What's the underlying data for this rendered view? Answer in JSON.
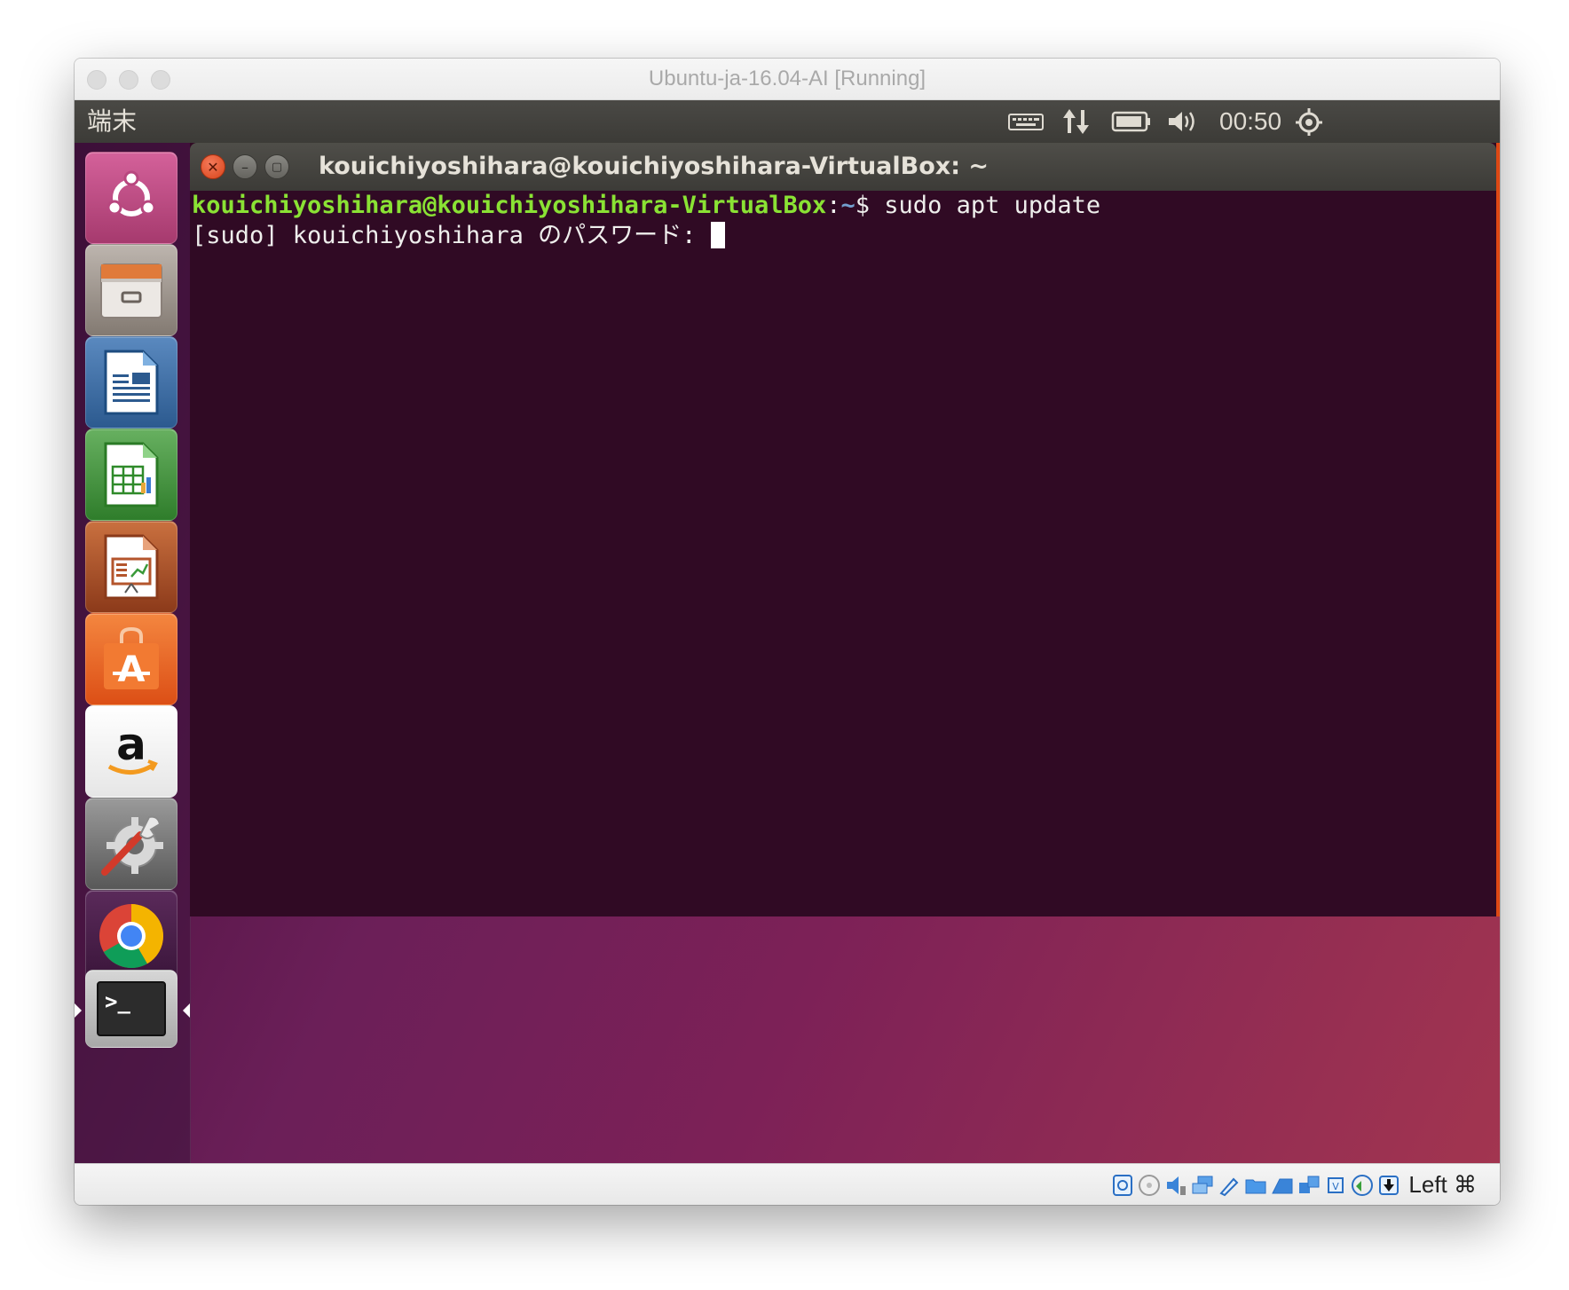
{
  "mac_window": {
    "title": "Ubuntu-ja-16.04-AI [Running]"
  },
  "ubuntu_panel": {
    "app_title": "端末",
    "clock": "00:50",
    "tray_icons": [
      "keyboard-icon",
      "network-icon",
      "battery-icon",
      "volume-icon",
      "power-icon"
    ]
  },
  "launcher": {
    "items": [
      {
        "name": "ubuntu-dash-icon",
        "color": "#c44a7d"
      },
      {
        "name": "files-icon",
        "color": "#9a8f86"
      },
      {
        "name": "writer-icon",
        "color": "#3d6fa3"
      },
      {
        "name": "calc-icon",
        "color": "#3e8e3a"
      },
      {
        "name": "impress-icon",
        "color": "#b4552c"
      },
      {
        "name": "software-center-icon",
        "color": "#e8651f"
      },
      {
        "name": "amazon-icon",
        "color": "#ffffff"
      },
      {
        "name": "system-settings-icon",
        "color": "#7d7d7d"
      },
      {
        "name": "chrome-icon",
        "color": "#4a1f4a"
      },
      {
        "name": "terminal-icon",
        "color": "#2c2c2c"
      }
    ]
  },
  "terminal": {
    "title": "kouichiyoshihara@kouichiyoshihara-VirtualBox: ~",
    "lines": {
      "prompt_user": "kouichiyoshihara@kouichiyoshihara-VirtualBox",
      "prompt_sep": ":",
      "prompt_path": "~",
      "prompt_sym": "$ ",
      "command": "sudo apt update",
      "sudo_prompt": "[sudo] kouichiyoshihara のパスワード: "
    }
  },
  "vbox_status": {
    "host_key": "Left ⌘",
    "icons": [
      "hdd-icon",
      "optical-drive-icon",
      "audio-icon",
      "network-adapter-icon",
      "usb-icon",
      "shared-folder-icon",
      "display-icon",
      "recording-icon",
      "cpu-icon",
      "mouse-integration-icon",
      "download-icon"
    ]
  }
}
